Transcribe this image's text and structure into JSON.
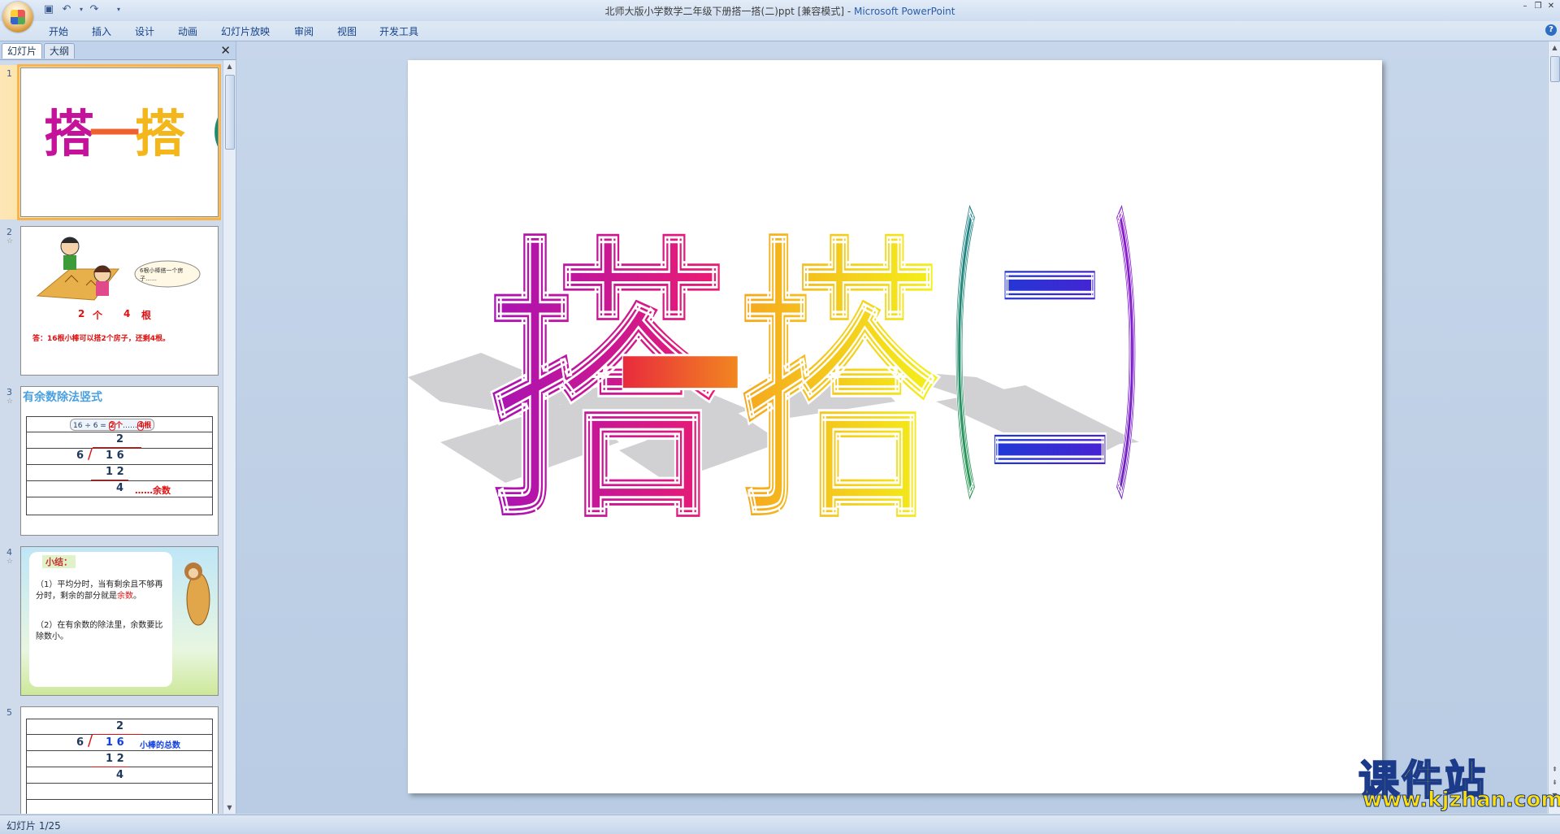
{
  "window": {
    "title": "北师大版小学数学二年级下册搭一搭(二)ppt [兼容模式]",
    "separator": " - ",
    "app": "Microsoft PowerPoint"
  },
  "ribbon": {
    "tabs": [
      "开始",
      "插入",
      "设计",
      "动画",
      "幻灯片放映",
      "审阅",
      "视图",
      "开发工具"
    ]
  },
  "left_pane": {
    "tabs": [
      "幻灯片",
      "大纲"
    ],
    "slides": [
      {
        "number": "1",
        "title_chars": [
          "搭",
          "一",
          "搭",
          "（",
          "二",
          "）"
        ]
      },
      {
        "number": "2",
        "bubble": "6根小棒搭一个房子……",
        "result": [
          "2",
          "个",
          "4",
          "根"
        ],
        "answer": "答：16根小棒可以搭2个房子，还剩4根。"
      },
      {
        "number": "3",
        "heading": "有余数除法竖式",
        "equation": [
          "16 ÷ 6 =",
          "2",
          "个",
          "……",
          "4",
          "根"
        ],
        "rows": [
          "2",
          "6",
          "1 6",
          "1 2",
          "4"
        ],
        "note": "……余数"
      },
      {
        "number": "4",
        "summary_label": "小结：",
        "point1_a": "（1）平均分时，当有剩余且不够再分时，剩余的部分就是",
        "point1_b": "余数",
        "point1_c": "。",
        "point2": "（2）在有余数的除法里，余数要比除数小。"
      },
      {
        "number": "5",
        "rows": [
          "2",
          "6",
          "1 6",
          "1 2",
          "4"
        ],
        "note": "小棒的总数"
      }
    ]
  },
  "slide": {
    "chars": [
      "搭",
      "一",
      "搭",
      "（",
      "二",
      "）"
    ],
    "colors": [
      "#c4139a",
      "#f0602c",
      "#f3b61b",
      "#1e8a6a",
      "#2230d6",
      "#7c1fc9"
    ]
  },
  "status": {
    "text": "幻灯片 1/25"
  },
  "watermark": {
    "name": "课件站",
    "url": "www.kjzhan.com"
  }
}
